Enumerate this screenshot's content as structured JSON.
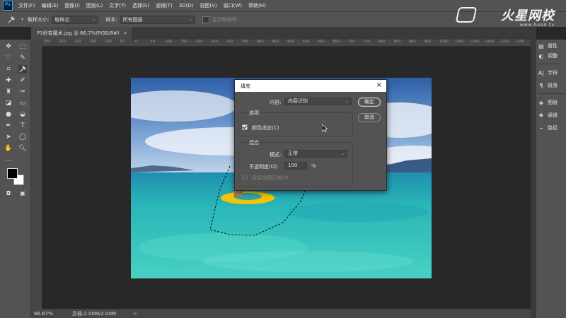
{
  "menubar": {
    "app_icon": "Ps",
    "items": [
      "文件(F)",
      "编辑(E)",
      "图像(I)",
      "图层(L)",
      "文字(Y)",
      "选择(S)",
      "滤镜(T)",
      "3D(D)",
      "视图(V)",
      "窗口(W)",
      "帮助(H)"
    ]
  },
  "watermark": {
    "title": "火星网校",
    "url": "www.hxsd.tv"
  },
  "options_bar": {
    "tool_icon": "eyedropper-icon",
    "sample_size_label": "取样大小:",
    "sample_size_value": "取样点",
    "sample_label": "样本:",
    "sample_value": "所有图层",
    "show_ring_label": "显示取样环"
  },
  "document": {
    "tab_title": "PS秒变魔术.jpg @ 66.7%(RGB/8#)"
  },
  "ruler": {
    "top_ticks": [
      "300",
      "250",
      "200",
      "150",
      "100",
      "50",
      "0",
      "50",
      "100",
      "150",
      "200",
      "250",
      "300",
      "350",
      "400",
      "450",
      "500",
      "550",
      "600",
      "650",
      "700",
      "750",
      "800",
      "850",
      "900",
      "950",
      "1000",
      "1050",
      "1100",
      "1150",
      "1200",
      "1250"
    ]
  },
  "status": {
    "zoom": "66.67%",
    "doc_info": "文档:2.00M/2.00M",
    "arrow": ">"
  },
  "right_panel": {
    "items": [
      {
        "icon": "properties-icon",
        "label": "属性"
      },
      {
        "icon": "adjustments-icon",
        "label": "调整"
      },
      {
        "icon": "character-icon",
        "label": "字符"
      },
      {
        "icon": "paragraph-icon",
        "label": "段落"
      },
      {
        "icon": "layers-icon",
        "label": "图层"
      },
      {
        "icon": "channels-icon",
        "label": "通道"
      },
      {
        "icon": "paths-icon",
        "label": "路径"
      }
    ]
  },
  "dialog": {
    "title": "填充",
    "content_label": "内容:",
    "content_value": "内容识别",
    "ok_label": "确定",
    "cancel_label": "取消",
    "options_group": "选项",
    "color_adapt_label": "颜色适应(C)",
    "color_adapt_checked": true,
    "blend_group": "混合",
    "mode_label": "模式:",
    "mode_value": "正常",
    "opacity_label": "不透明度(O):",
    "opacity_value": "100",
    "opacity_unit": "%",
    "preserve_label": "保留透明区域(P)",
    "preserve_checked": false
  }
}
